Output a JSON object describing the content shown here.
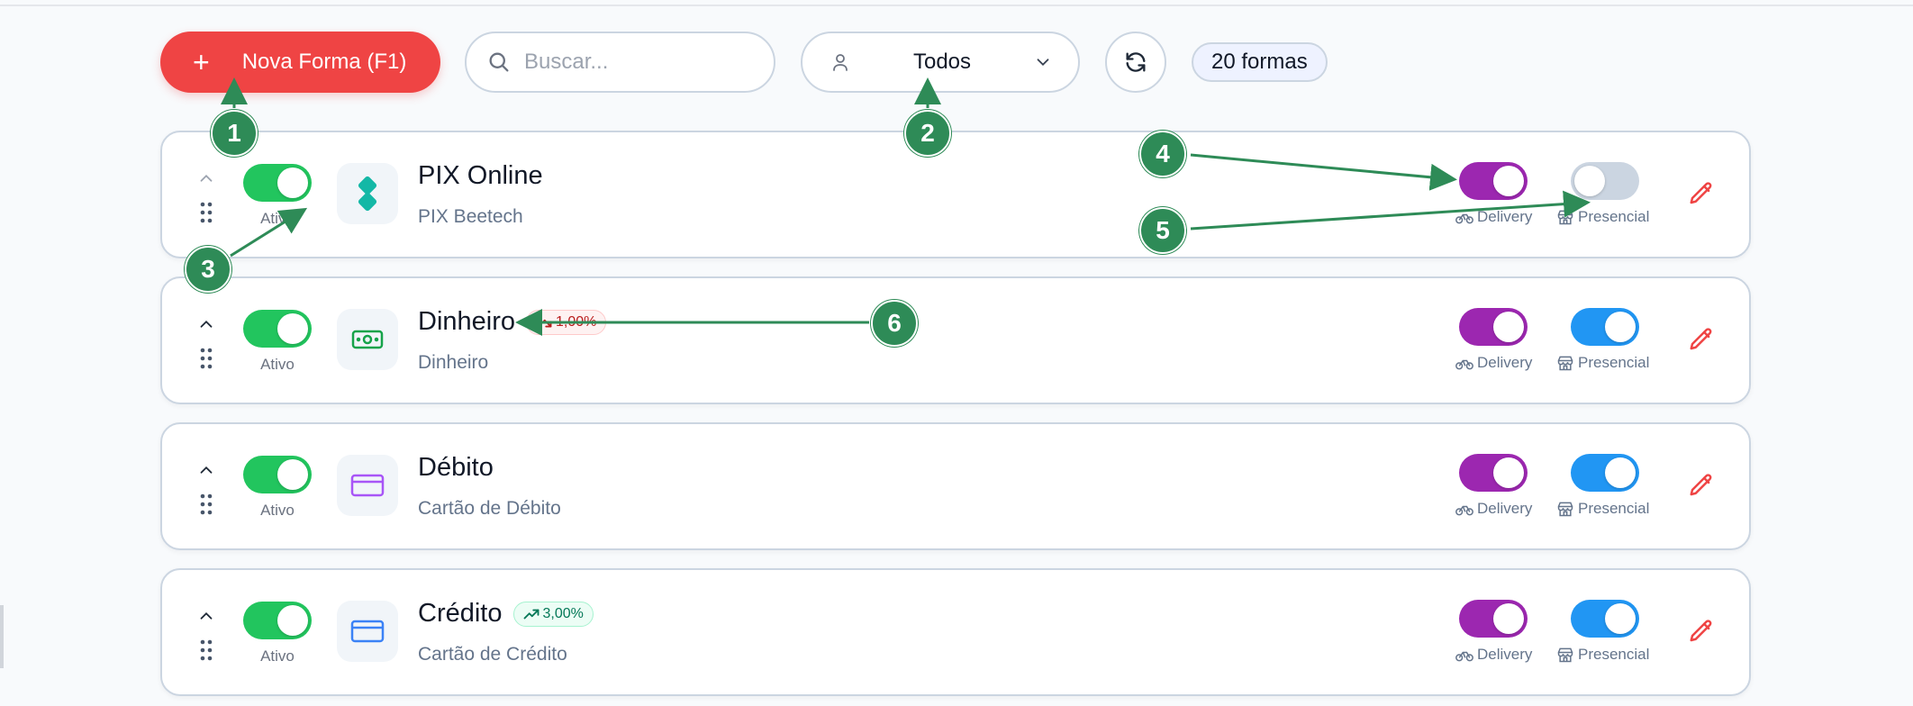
{
  "toolbar": {
    "new_button_label": "Nova Forma (F1)",
    "search_placeholder": "Buscar...",
    "filter_value": "Todos",
    "count_label": "20 formas"
  },
  "rows": [
    {
      "title": "PIX Online",
      "subtitle": "PIX Beetech",
      "badge": "",
      "status_label": "Ativo",
      "active": true,
      "delivery_label": "Delivery",
      "delivery_on": true,
      "presencial_label": "Presencial",
      "presencial_on": false,
      "icon": "pix-icon"
    },
    {
      "title": "Dinheiro",
      "subtitle": "Dinheiro",
      "badge": "1,00%",
      "badge_direction": "down",
      "status_label": "Ativo",
      "active": true,
      "delivery_label": "Delivery",
      "delivery_on": true,
      "presencial_label": "Presencial",
      "presencial_on": true,
      "icon": "cash-icon"
    },
    {
      "title": "Débito",
      "subtitle": "Cartão de Débito",
      "badge": "",
      "status_label": "Ativo",
      "active": true,
      "delivery_label": "Delivery",
      "delivery_on": true,
      "presencial_label": "Presencial",
      "presencial_on": true,
      "icon": "debit-card-icon"
    },
    {
      "title": "Crédito",
      "subtitle": "Cartão de Crédito",
      "badge": "3,00%",
      "badge_direction": "up",
      "status_label": "Ativo",
      "active": true,
      "delivery_label": "Delivery",
      "delivery_on": true,
      "presencial_label": "Presencial",
      "presencial_on": true,
      "icon": "credit-card-icon"
    }
  ],
  "annotations": [
    "1",
    "2",
    "3",
    "4",
    "5",
    "6"
  ],
  "colors": {
    "primary": "#ef4444",
    "active_toggle": "#22c55e",
    "delivery_toggle": "#9c27b0",
    "presencial_toggle": "#2196f3",
    "annotation": "#2e8b57"
  }
}
